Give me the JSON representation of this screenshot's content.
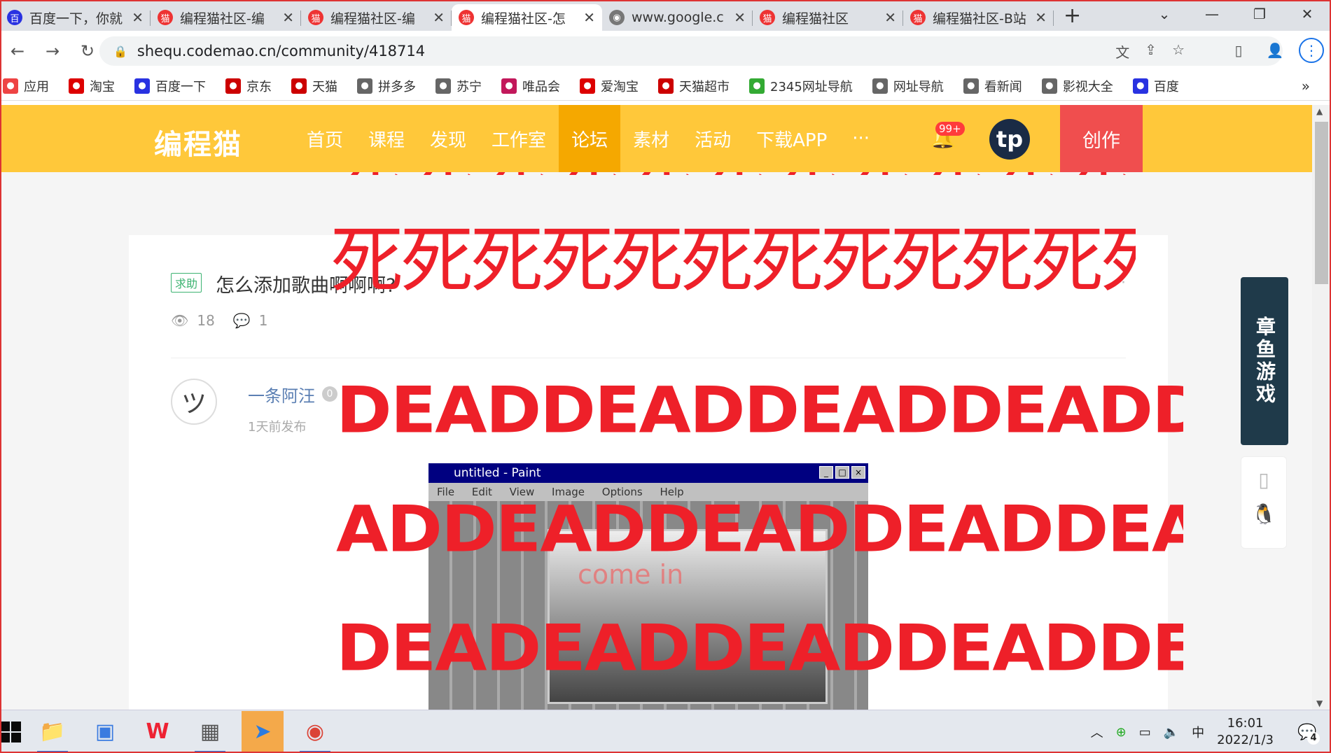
{
  "tabs": [
    {
      "title": "百度一下，你就",
      "color": "#2932e1",
      "icon": "百",
      "active": false
    },
    {
      "title": "编程猫社区-编",
      "color": "#e33",
      "icon": "猫",
      "active": false
    },
    {
      "title": "编程猫社区-编",
      "color": "#e33",
      "icon": "猫",
      "active": false
    },
    {
      "title": "编程猫社区-怎",
      "color": "#e33",
      "icon": "猫",
      "active": true
    },
    {
      "title": "www.google.c",
      "color": "#777",
      "icon": "◉",
      "active": false
    },
    {
      "title": "编程猫社区",
      "color": "#e33",
      "icon": "猫",
      "active": false
    },
    {
      "title": "编程猫社区-B站",
      "color": "#e33",
      "icon": "猫",
      "active": false
    }
  ],
  "window": {
    "new_tab": "+",
    "dropdown": "⌄",
    "minimize": "—",
    "restore": "❐",
    "close": "✕"
  },
  "toolbar": {
    "url": "shequ.codemao.cn/community/418714"
  },
  "bookmarks": [
    {
      "label": "应用",
      "color": "#e44"
    },
    {
      "label": "淘宝",
      "color": "#d00"
    },
    {
      "label": "百度一下",
      "color": "#2932e1"
    },
    {
      "label": "京东",
      "color": "#c00"
    },
    {
      "label": "天猫",
      "color": "#c00"
    },
    {
      "label": "拼多多",
      "color": "#666"
    },
    {
      "label": "苏宁",
      "color": "#666"
    },
    {
      "label": "唯品会",
      "color": "#c2185b"
    },
    {
      "label": "爱淘宝",
      "color": "#d00"
    },
    {
      "label": "天猫超市",
      "color": "#c00"
    },
    {
      "label": "2345网址导航",
      "color": "#3a3"
    },
    {
      "label": "网址导航",
      "color": "#666"
    },
    {
      "label": "看新闻",
      "color": "#666"
    },
    {
      "label": "影视大全",
      "color": "#666"
    },
    {
      "label": "百度",
      "color": "#2932e1"
    }
  ],
  "site": {
    "logo": "编程猫",
    "nav": [
      "首页",
      "课程",
      "发现",
      "工作室",
      "论坛",
      "素材",
      "活动",
      "下载APP",
      "···"
    ],
    "nav_active": "论坛",
    "badge": "99+",
    "avatar": "tp",
    "create": "创作"
  },
  "post": {
    "tag": "求助",
    "title": "怎么添加歌曲啊啊啊?",
    "views": "18",
    "comments": "1",
    "author": "一条阿汪",
    "level": "0",
    "time": "1天前发布"
  },
  "paint": {
    "title": "untitled - Paint",
    "menu": "File Edit View Image Options Help",
    "inner_text": "come in"
  },
  "overlay": {
    "cn": "死死死死死死死死死死死死",
    "en1": "DEADDEADDEADDEADDE",
    "en2": "ADDEADDEADDEADDEAD",
    "en3": "DEADEADDEADDEADDEA"
  },
  "ad": {
    "text": "章鱼游戏"
  },
  "taskbar": {
    "ime": "中",
    "time": "16:01",
    "date": "2022/1/3",
    "notif_count": "4"
  }
}
